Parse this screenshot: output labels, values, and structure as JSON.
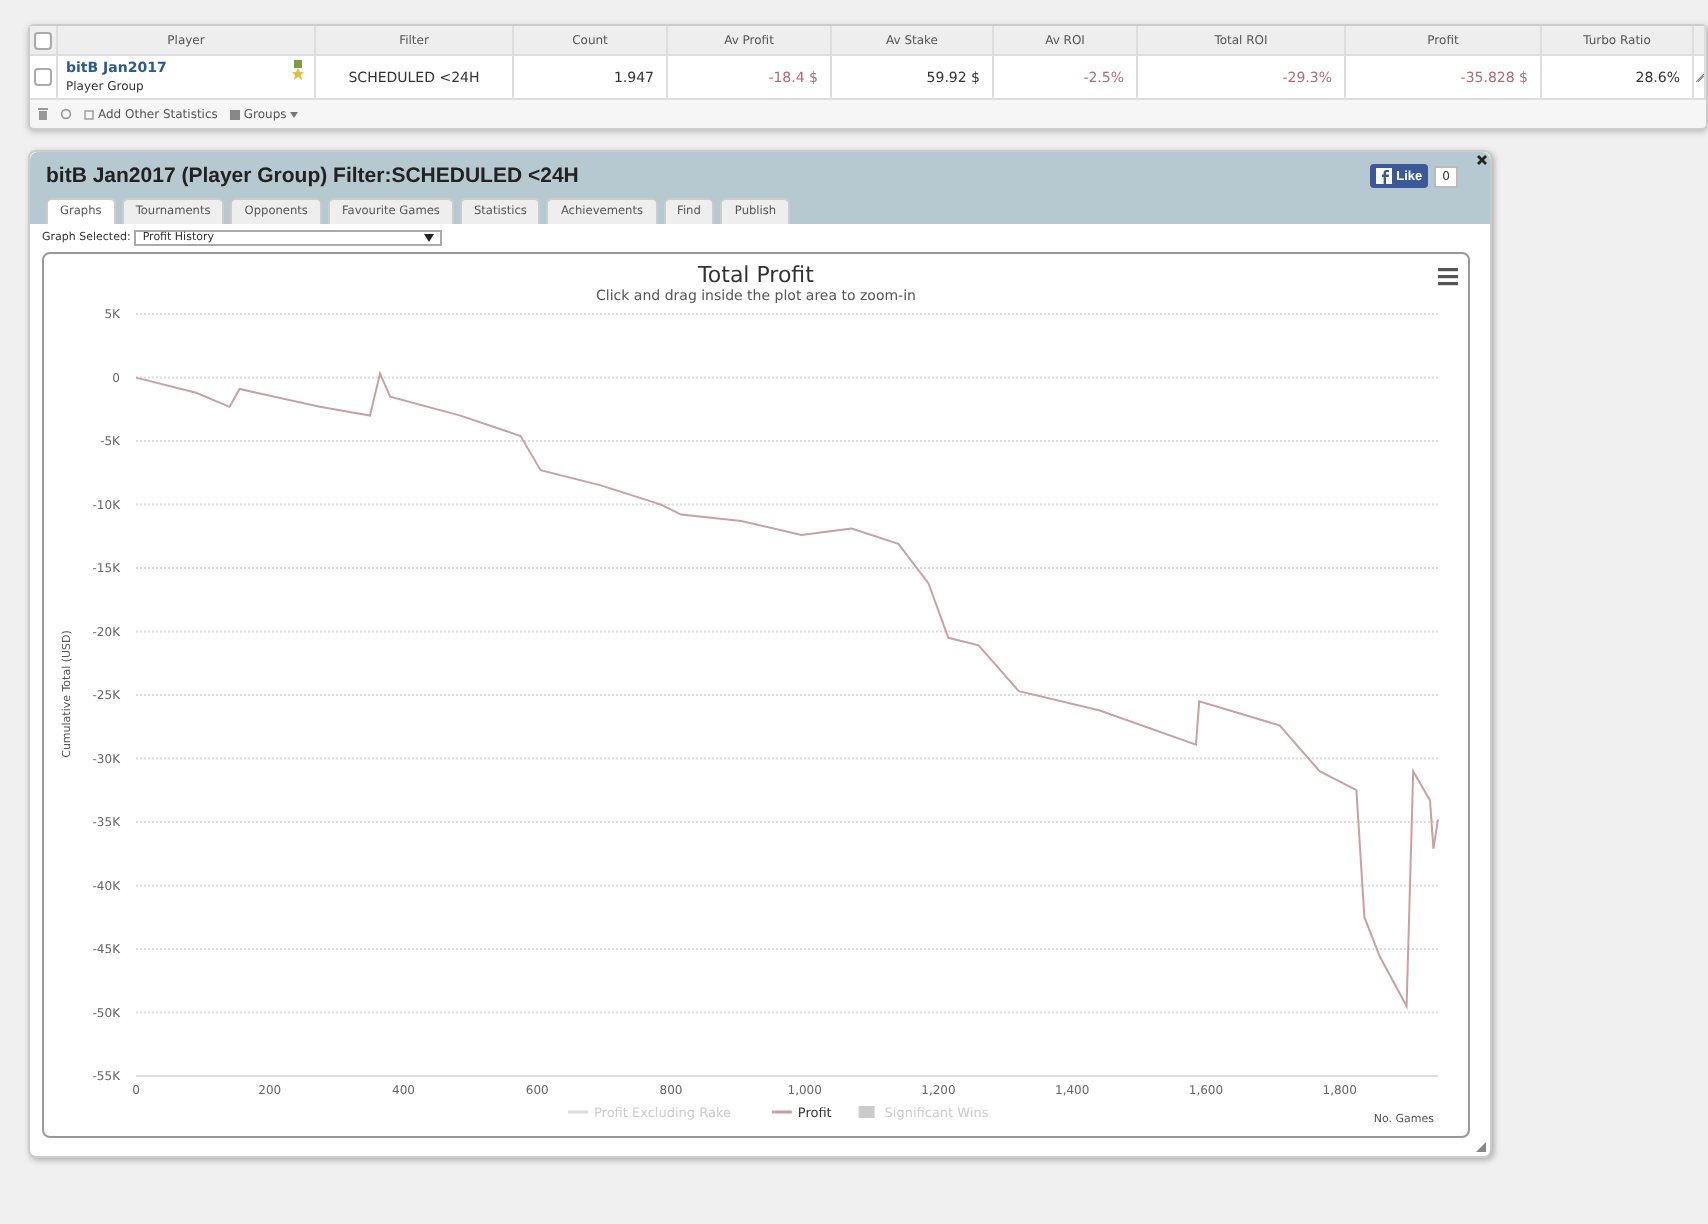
{
  "stats_table": {
    "columns": [
      "Player",
      "Filter",
      "Count",
      "Av Profit",
      "Av Stake",
      "Av ROI",
      "Total ROI",
      "Profit",
      "Turbo Ratio"
    ],
    "rows": [
      {
        "checked": false,
        "cells": [
          {
            "kind": "player",
            "text": "bitB Jan2017",
            "subtext": "Player Group"
          },
          {
            "kind": "value",
            "text": "SCHEDULED <24H",
            "negative": false
          },
          {
            "kind": "value",
            "text": "1.947",
            "negative": false
          },
          {
            "kind": "value",
            "text": "-18.4 $",
            "negative": true
          },
          {
            "kind": "value",
            "text": "59.92 $",
            "negative": false
          },
          {
            "kind": "value",
            "text": "-2.5%",
            "negative": true
          },
          {
            "kind": "value",
            "text": "-29.3%",
            "negative": true
          },
          {
            "kind": "value",
            "text": "-35.828 $",
            "negative": true
          },
          {
            "kind": "value",
            "text": "28.6%",
            "negative": false
          }
        ]
      }
    ],
    "header_checked": false,
    "footer": {
      "add_label": "Add Other Statistics",
      "groups_label": "Groups"
    }
  },
  "widget": {
    "title": "bitB Jan2017 (Player Group) Filter:SCHEDULED <24H",
    "like_label": "Like",
    "like_count": "0",
    "tabs": [
      {
        "label": "Graphs",
        "selected": true
      },
      {
        "label": "Tournaments",
        "selected": false
      },
      {
        "label": "Opponents",
        "selected": false
      },
      {
        "label": "Favourite Games",
        "selected": false
      },
      {
        "label": "Statistics",
        "selected": false
      },
      {
        "label": "Achievements",
        "selected": false
      },
      {
        "label": "Find",
        "selected": false
      },
      {
        "label": "Publish",
        "selected": false
      }
    ],
    "graph_select": {
      "label": "Graph Selected:",
      "value": "Profit History"
    },
    "chart": {
      "subtitle": "Click and drag inside the plot area to zoom-in",
      "hidden_legend": [
        {
          "label": "Profit Excluding Rake",
          "kind": "line",
          "visible": false
        },
        {
          "label": "Significant Wins",
          "kind": "area",
          "visible": false
        }
      ],
      "chart_data": {
        "type": "line",
        "title": "Total Profit",
        "xlabel": "No. Games",
        "ylabel": "Cumulative Total (USD)",
        "grid": true,
        "x": [
          0,
          90,
          140,
          155,
          275,
          350,
          365,
          380,
          485,
          575,
          605,
          695,
          785,
          815,
          905,
          995,
          1070,
          1140,
          1185,
          1215,
          1260,
          1320,
          1440,
          1585,
          1590,
          1710,
          1770,
          1825,
          1837,
          1860,
          1900,
          1910,
          1935,
          1940,
          1947
        ],
        "series": [
          {
            "name": "Profit",
            "color": "#c9a0a6",
            "values": [
              0,
              -1200,
              -2300,
              -900,
              -2300,
              -3000,
              300,
              -1500,
              -3000,
              -4600,
              -7300,
              -8500,
              -10000,
              -10800,
              -11300,
              -12400,
              -11900,
              -13100,
              -16200,
              -20500,
              -21100,
              -24700,
              -26200,
              -28900,
              -25500,
              -27400,
              -31000,
              -32500,
              -42500,
              -45600,
              -49500,
              -31000,
              -33300,
              -37100,
              -34800
            ]
          }
        ],
        "xlim": [
          0,
          1947
        ],
        "ylim": [
          -55000,
          5000
        ],
        "xticks": [
          {
            "value": 0,
            "label": "0"
          },
          {
            "value": 200,
            "label": "200"
          },
          {
            "value": 400,
            "label": "400"
          },
          {
            "value": 600,
            "label": "600"
          },
          {
            "value": 800,
            "label": "800"
          },
          {
            "value": 1000,
            "label": "1,000"
          },
          {
            "value": 1200,
            "label": "1,200"
          },
          {
            "value": 1400,
            "label": "1,400"
          },
          {
            "value": 1600,
            "label": "1,600"
          },
          {
            "value": 1800,
            "label": "1,800"
          }
        ],
        "yticks": [
          {
            "value": 5000,
            "label": "5K"
          },
          {
            "value": 0,
            "label": "0"
          },
          {
            "value": -5000,
            "label": "-5K"
          },
          {
            "value": -10000,
            "label": "-10K"
          },
          {
            "value": -15000,
            "label": "-15K"
          },
          {
            "value": -20000,
            "label": "-20K"
          },
          {
            "value": -25000,
            "label": "-25K"
          },
          {
            "value": -30000,
            "label": "-30K"
          },
          {
            "value": -35000,
            "label": "-35K"
          },
          {
            "value": -40000,
            "label": "-40K"
          },
          {
            "value": -45000,
            "label": "-45K"
          },
          {
            "value": -50000,
            "label": "-50K"
          },
          {
            "value": -55000,
            "label": "-55K"
          }
        ]
      }
    }
  }
}
